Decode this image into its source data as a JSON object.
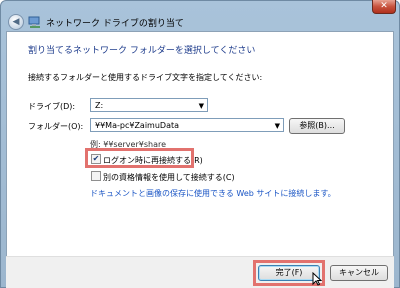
{
  "window": {
    "title": "ネットワーク ドライブの割り当て",
    "close_glyph": "✕",
    "back_glyph": "◀"
  },
  "content": {
    "heading": "割り当てるネットワーク フォルダーを選択してください",
    "instruction": "接続するフォルダーと使用するドライブ文字を指定してください:",
    "drive_label": "ドライブ(D):",
    "drive_value": "Z:",
    "folder_label": "フォルダー(O):",
    "folder_value": "¥¥Ma-pc¥ZaimuData",
    "browse_label": "参照(B)...",
    "example": "例: ¥¥server¥share",
    "reconnect_label": "ログオン時に再接続する(R)",
    "reconnect_checked": true,
    "other_credentials_label": "別の資格情報を使用して接続する(C)",
    "other_credentials_checked": false,
    "link_text": "ドキュメントと画像の保存に使用できる Web サイトに接続します。"
  },
  "footer": {
    "finish_label": "完了(F)",
    "cancel_label": "キャンセル"
  },
  "colors": {
    "highlight": "#e2726e",
    "heading": "#1e3c8c",
    "link": "#1a55c5"
  }
}
